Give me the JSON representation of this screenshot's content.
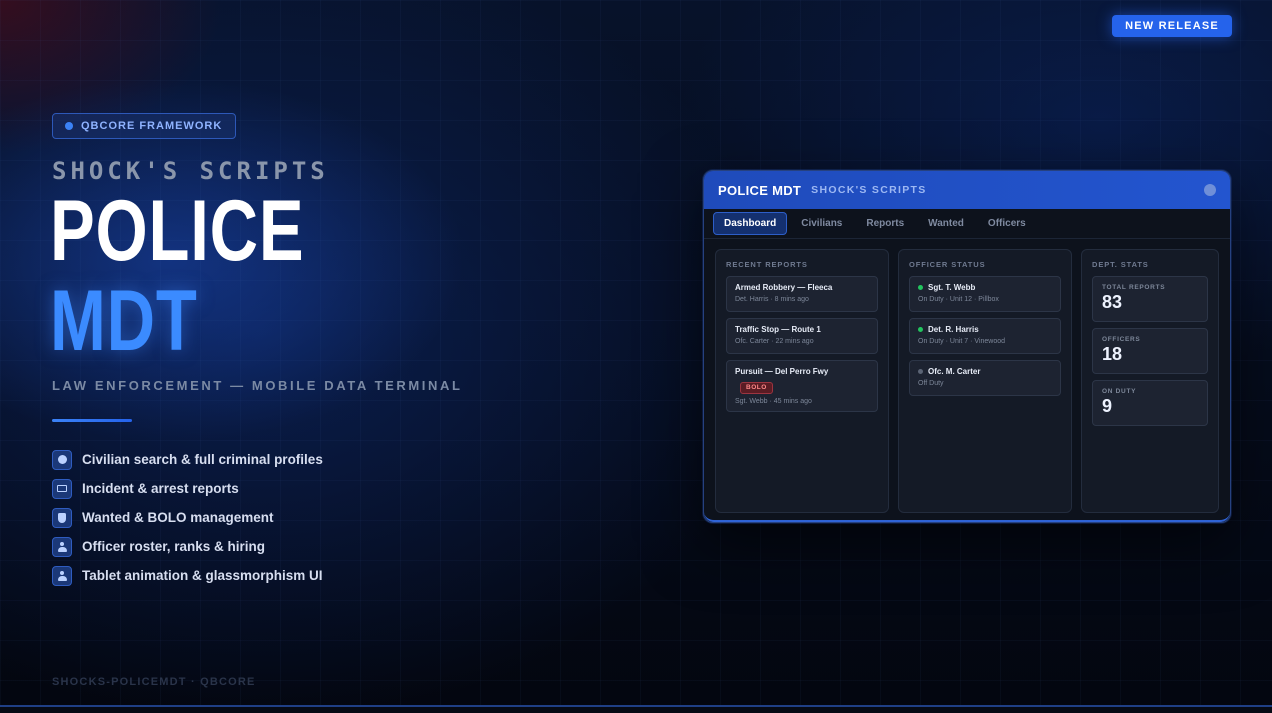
{
  "release_badge": "NEW RELEASE",
  "framework_badge": "QBCORE FRAMEWORK",
  "brand": "SHOCK'S SCRIPTS",
  "title_line1": "POLICE",
  "title_line2": "MDT",
  "subtitle": "LAW ENFORCEMENT — MOBILE DATA TERMINAL",
  "features": [
    {
      "icon": "info-icon",
      "label": "Civilian search & full criminal profiles"
    },
    {
      "icon": "report-icon",
      "label": "Incident & arrest reports"
    },
    {
      "icon": "shield-icon",
      "label": "Wanted & BOLO management"
    },
    {
      "icon": "user-icon",
      "label": "Officer roster, ranks & hiring"
    },
    {
      "icon": "user-icon",
      "label": "Tablet animation & glassmorphism UI"
    }
  ],
  "footer_note": "SHOCKS-POLICEMDT · QBCORE",
  "mdt": {
    "title": "POLICE MDT",
    "subtitle": "SHOCK'S SCRIPTS",
    "tabs": [
      "Dashboard",
      "Civilians",
      "Reports",
      "Wanted",
      "Officers"
    ],
    "active_tab": "Dashboard",
    "recent_reports": {
      "heading": "RECENT REPORTS",
      "items": [
        {
          "title": "Armed Robbery — Fleeca",
          "meta": "Det. Harris · 8 mins ago"
        },
        {
          "title": "Traffic Stop — Route 1",
          "meta": "Ofc. Carter · 22 mins ago"
        },
        {
          "title": "Pursuit — Del Perro Fwy",
          "tag": "BOLO",
          "meta": "Sgt. Webb · 45 mins ago"
        }
      ]
    },
    "officer_status": {
      "heading": "OFFICER STATUS",
      "items": [
        {
          "name": "Sgt. T. Webb",
          "status": "On Duty · Unit 12 · Pillbox",
          "dot_color": "#22c55e"
        },
        {
          "name": "Det. R. Harris",
          "status": "On Duty · Unit 7 · Vinewood",
          "dot_color": "#22c55e"
        },
        {
          "name": "Ofc. M. Carter",
          "status": "Off Duty",
          "dot_color": "#5b6475"
        }
      ]
    },
    "dept_stats": {
      "heading": "DEPT. STATS",
      "items": [
        {
          "label": "TOTAL REPORTS",
          "value": "83"
        },
        {
          "label": "OFFICERS",
          "value": "18"
        },
        {
          "label": "ON DUTY",
          "value": "9"
        }
      ]
    }
  },
  "colors": {
    "accent": "#2563eb",
    "title_blue": "#3b8bff",
    "on_duty": "#22c55e",
    "bolo": "#ff8a8a"
  }
}
